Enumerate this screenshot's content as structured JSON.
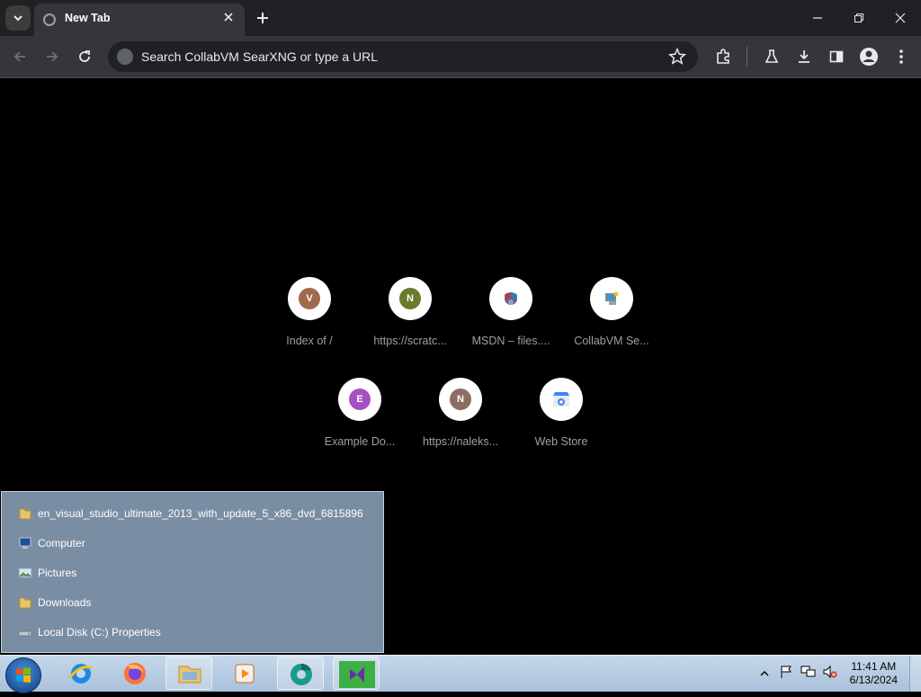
{
  "tab": {
    "title": "New Tab"
  },
  "omnibox": {
    "placeholder": "Search CollabVM SearXNG or type a URL"
  },
  "shortcuts": [
    {
      "label": "Index of /",
      "letter": "V",
      "color": "#a16a4f"
    },
    {
      "label": "https://scratc...",
      "letter": "N",
      "color": "#6a7b2c"
    },
    {
      "label": "MSDN – files....",
      "icon": "msdn-logo"
    },
    {
      "label": "CollabVM Se...",
      "icon": "collabvm-logo"
    },
    {
      "label": "Example Do...",
      "letter": "E",
      "color": "#a64fc4"
    },
    {
      "label": "https://naleks...",
      "letter": "N",
      "color": "#8d6e63"
    },
    {
      "label": "Web Store",
      "icon": "webstore-icon"
    }
  ],
  "jumplist": {
    "items": [
      {
        "label": "en_visual_studio_ultimate_2013_with_update_5_x86_dvd_6815896",
        "icon": "folder-icon"
      },
      {
        "label": "Computer",
        "icon": "computer-icon"
      },
      {
        "label": "Pictures",
        "icon": "pictures-icon"
      },
      {
        "label": "Downloads",
        "icon": "folder-icon"
      },
      {
        "label": "Local Disk (C:) Properties",
        "icon": "drive-icon"
      }
    ]
  },
  "clock": {
    "time": "11:41 AM",
    "date": "6/13/2024"
  }
}
